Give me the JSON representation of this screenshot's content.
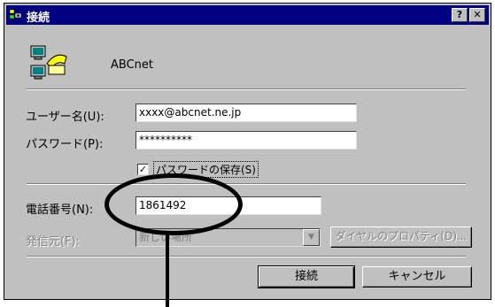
{
  "window": {
    "title": "接続",
    "help_label": "?",
    "close_label": "✕"
  },
  "connection": {
    "name": "ABCnet",
    "icon": "dialup-connection-icon"
  },
  "form": {
    "username_label": "ユーザー名(U):",
    "username_value": "xxxx@abcnet.ne.jp",
    "password_label": "パスワード(P):",
    "password_value": "**********",
    "save_password_label": "パスワードの保存(S)",
    "save_password_checked": true,
    "phone_label": "電話番号(N):",
    "phone_value": "1861492",
    "dial_from_label": "発信元(F):",
    "dial_from_value": "新しい場所",
    "dialing_properties_label": "ダイヤルのプロパティ(D)..."
  },
  "buttons": {
    "connect_label": "接続",
    "cancel_label": "キャンセル"
  },
  "colors": {
    "titlebar": "#000080",
    "dialog": "#c0c0c0",
    "disabled_text": "#808080"
  }
}
